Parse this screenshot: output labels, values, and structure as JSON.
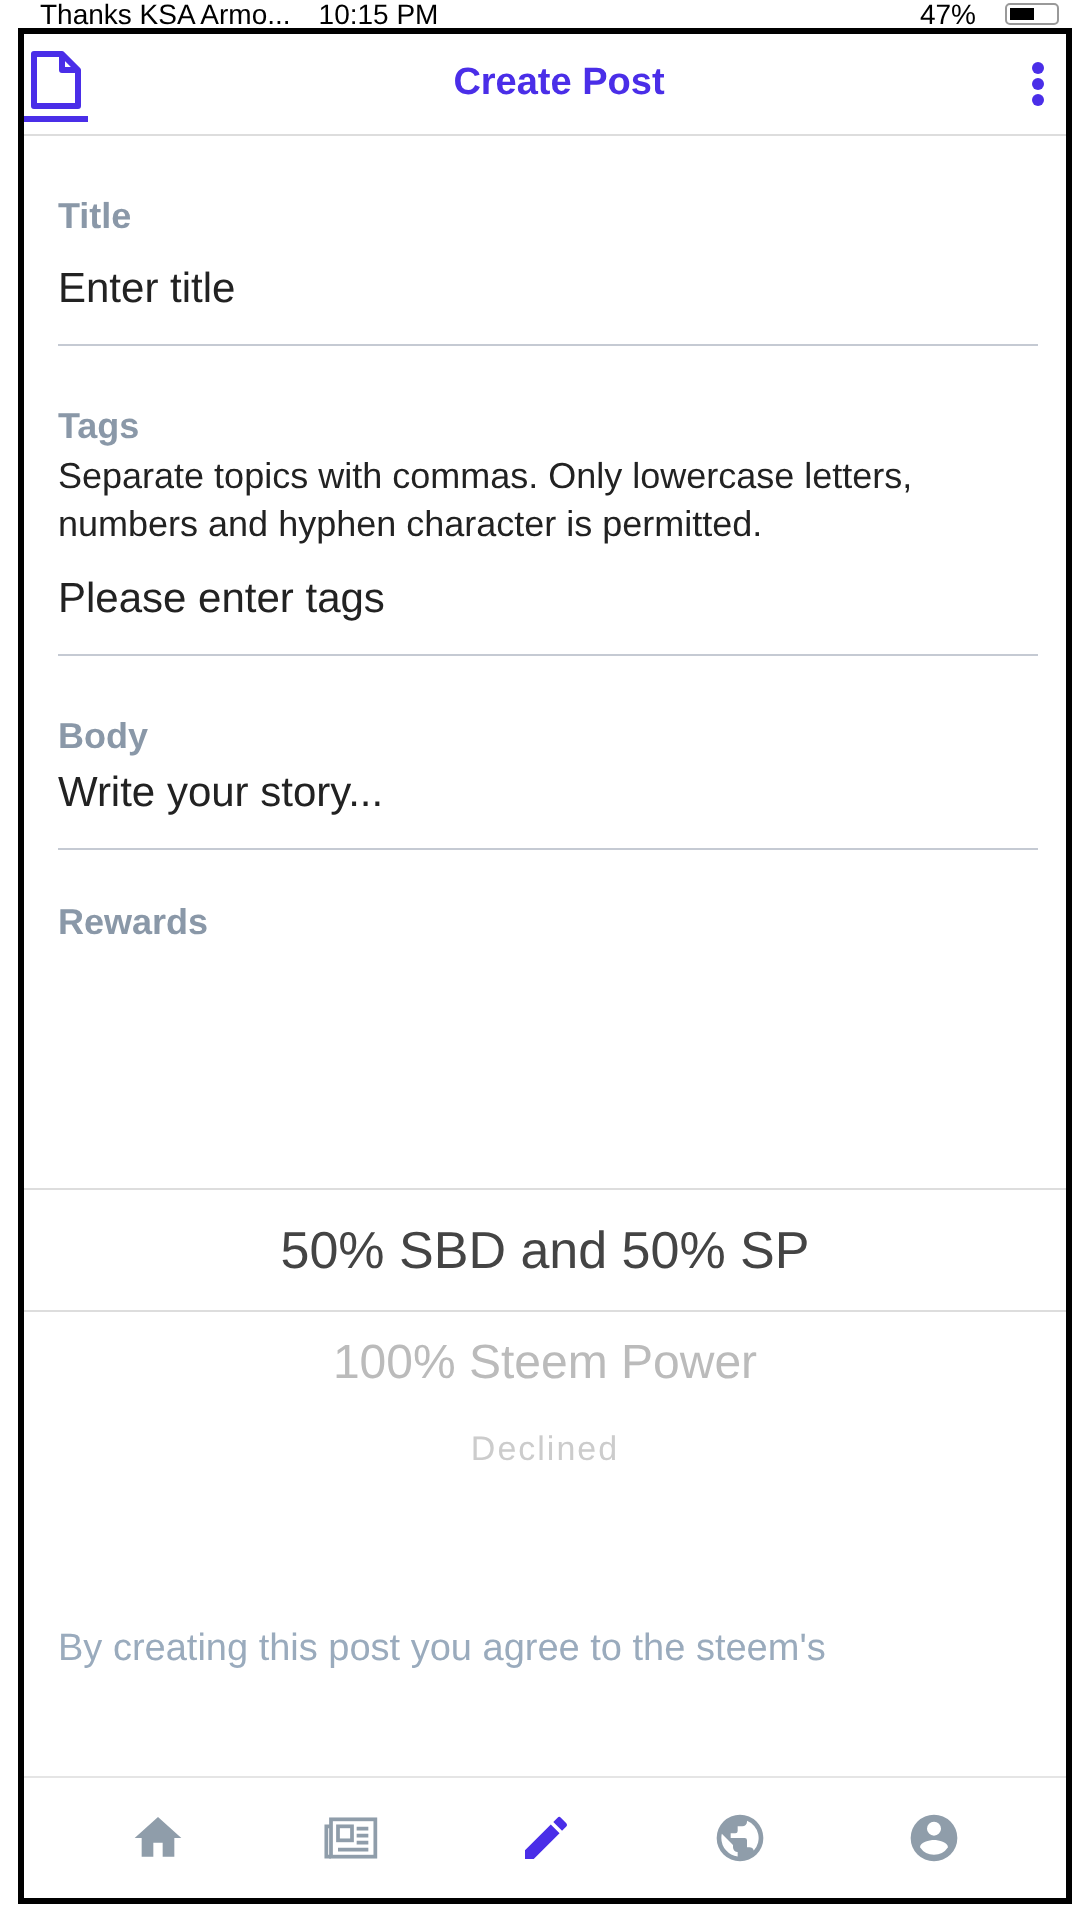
{
  "status_bar": {
    "carrier": "Thanks KSA Armo...",
    "time": "10:15 PM",
    "battery": "47%"
  },
  "header": {
    "title": "Create Post"
  },
  "form": {
    "fields": [
      {
        "label": "Title",
        "placeholder": "Enter title"
      },
      {
        "label": "Tags",
        "hint": "Separate topics with commas. Only lowercase letters, numbers and hyphen character is permitted.",
        "placeholder": "Please enter tags"
      },
      {
        "label": "Body",
        "placeholder": "Write your story..."
      }
    ],
    "rewards": {
      "label": "Rewards",
      "options": [
        {
          "label": "50% SBD and 50% SP",
          "selected": true
        },
        {
          "label": "100% Steem Power",
          "selected": false
        },
        {
          "label": "Declined",
          "selected": false
        }
      ]
    },
    "agreement": "By creating this post you agree to the steem's"
  },
  "tab_bar": [
    {
      "kind": "home",
      "selected": false
    },
    {
      "kind": "news",
      "selected": false
    },
    {
      "kind": "write",
      "selected": true
    },
    {
      "kind": "globe",
      "selected": false
    },
    {
      "kind": "profile",
      "selected": false
    }
  ]
}
